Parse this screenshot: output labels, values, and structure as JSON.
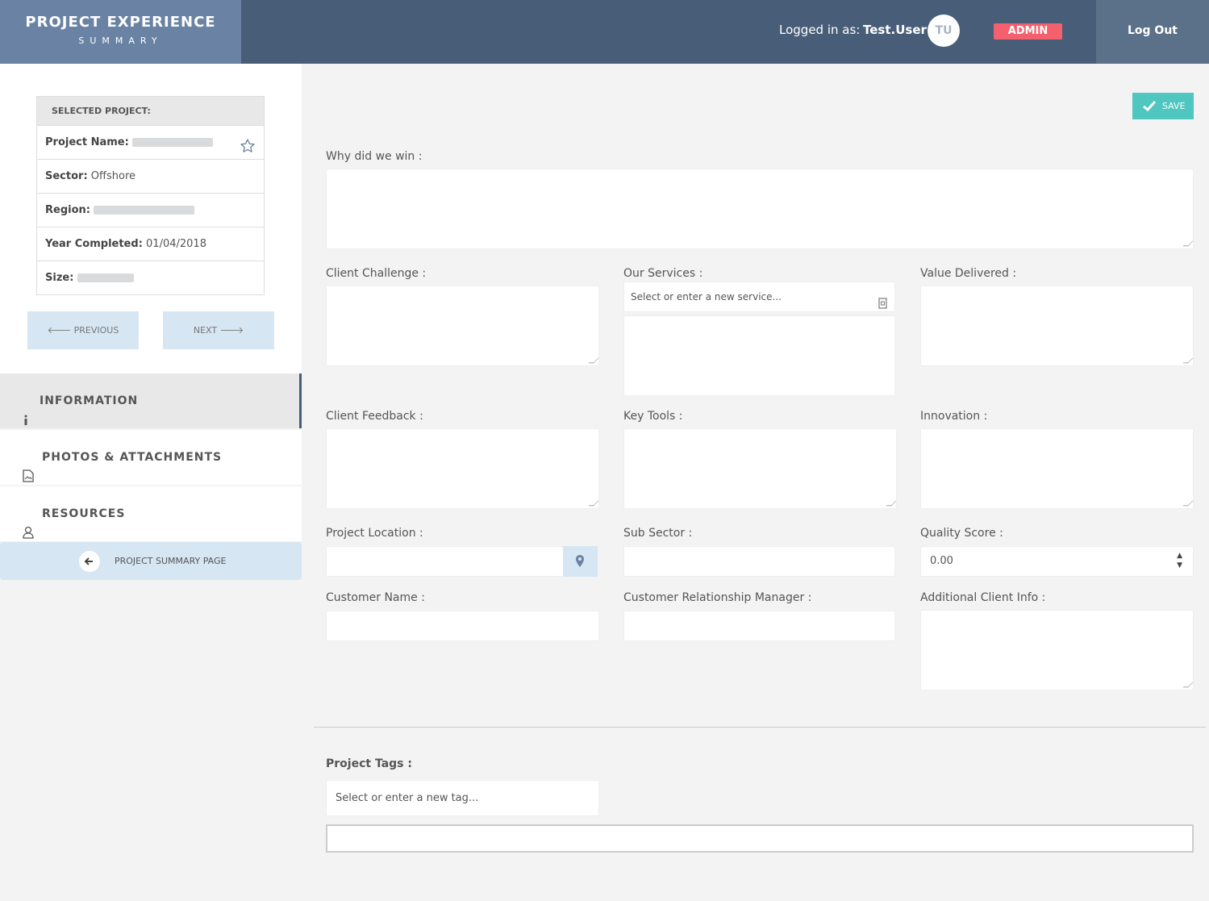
{
  "brand": {
    "title": "PROJECT EXPERIENCE",
    "subtitle": "SUMMARY"
  },
  "header": {
    "logged_in_label": "Logged in as:",
    "username": "Test.User",
    "avatar_initials": "TU",
    "role_badge": "ADMIN",
    "logout_label": "Log Out"
  },
  "project_card": {
    "header": "SELECTED PROJECT:",
    "name_label": "Project Name:",
    "sector_label": "Sector:",
    "sector_value": "Offshore",
    "region_label": "Region:",
    "year_label": "Year Completed:",
    "year_value": "01/04/2018",
    "size_label": "Size:"
  },
  "nav": {
    "previous": "PREVIOUS",
    "next": "NEXT"
  },
  "menu": {
    "information": "INFORMATION",
    "photos": "PHOTOS & ATTACHMENTS",
    "resources": "RESOURCES",
    "summary_page": "PROJECT SUMMARY PAGE"
  },
  "form": {
    "save": "SAVE",
    "why_win": "Why did we win :",
    "client_challenge": "Client Challenge :",
    "our_services": "Our Services :",
    "services_placeholder": "Select or enter a new service...",
    "value_delivered": "Value Delivered :",
    "client_feedback": "Client Feedback :",
    "key_tools": "Key Tools :",
    "innovation": "Innovation :",
    "project_location": "Project Location :",
    "sub_sector": "Sub Sector :",
    "quality_score": "Quality Score :",
    "quality_value": "0.00",
    "customer_name": "Customer Name :",
    "crm": "Customer Relationship Manager :",
    "additional_info": "Additional Client Info :",
    "project_tags": "Project Tags :",
    "tags_placeholder": "Select or enter a new tag..."
  },
  "colors": {
    "header_bg": "#485e78",
    "brand_bg": "#6a83a4",
    "logout_bg": "#5b7089",
    "admin_badge": "#f5606e",
    "save_button": "#4fc6c0",
    "nav_button": "#d6e6f3"
  }
}
